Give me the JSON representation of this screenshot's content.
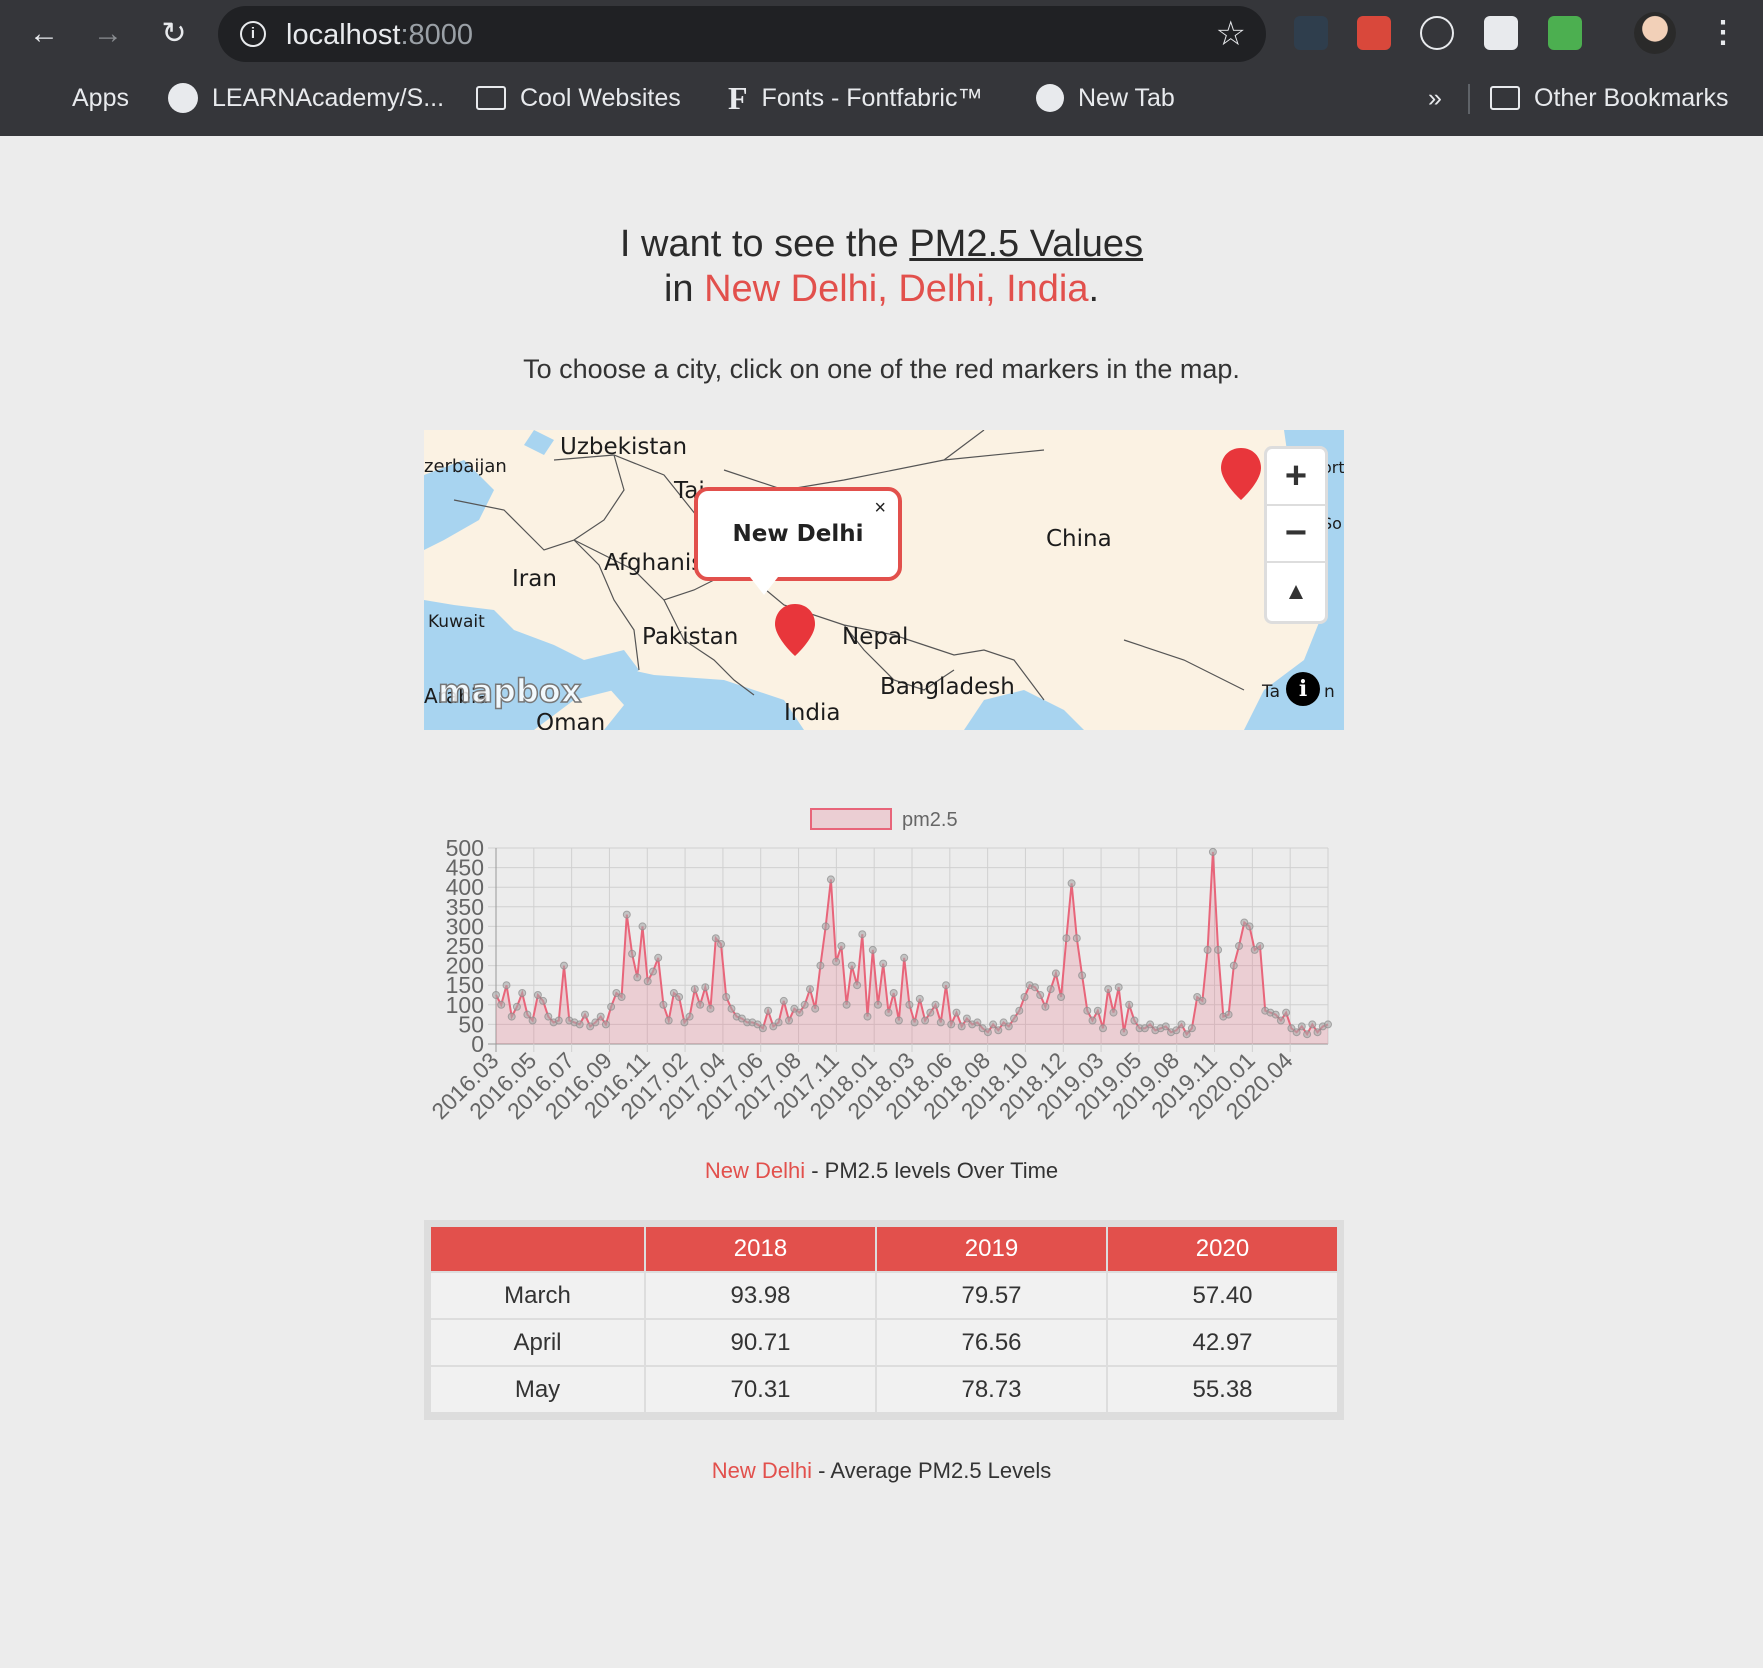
{
  "browser": {
    "url_host": "localhost",
    "url_port": ":8000",
    "bookmarks": [
      "Apps",
      "LEARNAcademy/S...",
      "Cool Websites",
      "Fonts - Fontfabric™",
      "New Tab"
    ],
    "overflow": "»",
    "other_bookmarks": "Other Bookmarks"
  },
  "page": {
    "headline_prefix": "I want to see the ",
    "headline_metric": "PM2.5 Values",
    "headline_in": "in ",
    "headline_city": "New Delhi, Delhi, India",
    "headline_period": ".",
    "instructions": "To choose a city, click on one of the red markers in the map."
  },
  "map": {
    "labels": [
      "Uzbekistan",
      "zerbaijan",
      "Taj",
      "China",
      "Iran",
      "Afghanis",
      "Kuwait",
      "Pakistan",
      "Nepal",
      "Bangladesh",
      "India",
      "Oman",
      "Arabia",
      "ort",
      "So",
      "Ta",
      "n"
    ],
    "popup_title": "New Delhi",
    "popup_close": "×",
    "zoom_in": "+",
    "zoom_out": "−",
    "compass": "▲",
    "attribution_logo": "mapbox",
    "info": "i"
  },
  "chart_data": {
    "type": "line",
    "legend": [
      "pm2.5"
    ],
    "legend_position": "top",
    "ylim": [
      0,
      500
    ],
    "yticks": [
      0,
      50,
      100,
      150,
      200,
      250,
      300,
      350,
      400,
      450,
      500
    ],
    "xticks": [
      "2016.03",
      "2016.05",
      "2016.07",
      "2016.09",
      "2016.11",
      "2017.02",
      "2017.04",
      "2017.06",
      "2017.08",
      "2017.11",
      "2018.01",
      "2018.03",
      "2018.06",
      "2018.08",
      "2018.10",
      "2018.12",
      "2019.03",
      "2019.05",
      "2019.08",
      "2019.11",
      "2020.01",
      "2020.04"
    ],
    "grid": true,
    "series": [
      {
        "name": "pm2.5",
        "color": "#e8657a",
        "fill": "rgba(232,101,122,0.22)",
        "values": [
          125,
          100,
          150,
          70,
          95,
          130,
          75,
          60,
          125,
          110,
          70,
          55,
          60,
          200,
          60,
          55,
          50,
          75,
          45,
          55,
          70,
          50,
          95,
          130,
          120,
          330,
          230,
          170,
          300,
          160,
          185,
          220,
          100,
          60,
          130,
          120,
          55,
          70,
          140,
          100,
          145,
          90,
          270,
          255,
          120,
          90,
          70,
          65,
          55,
          55,
          50,
          40,
          85,
          45,
          55,
          110,
          60,
          90,
          80,
          100,
          140,
          90,
          200,
          300,
          420,
          210,
          250,
          100,
          200,
          150,
          280,
          70,
          240,
          100,
          205,
          80,
          130,
          60,
          220,
          100,
          55,
          115,
          60,
          80,
          100,
          55,
          150,
          50,
          80,
          45,
          65,
          50,
          55,
          40,
          30,
          50,
          35,
          55,
          45,
          65,
          85,
          120,
          150,
          145,
          125,
          95,
          140,
          180,
          120,
          270,
          410,
          270,
          175,
          85,
          60,
          85,
          40,
          140,
          80,
          145,
          30,
          100,
          60,
          40,
          40,
          50,
          35,
          40,
          45,
          30,
          35,
          50,
          25,
          40,
          120,
          110,
          240,
          490,
          240,
          70,
          75,
          200,
          250,
          310,
          300,
          240,
          250,
          85,
          80,
          75,
          60,
          80,
          40,
          30,
          45,
          25,
          50,
          30,
          45,
          50
        ]
      }
    ]
  },
  "chart_caption_city": "New Delhi",
  "chart_caption_rest": " - PM2.5 levels Over Time",
  "table": {
    "headers": [
      "",
      "2018",
      "2019",
      "2020"
    ],
    "rows": [
      [
        "March",
        "93.98",
        "79.57",
        "57.40"
      ],
      [
        "April",
        "90.71",
        "76.56",
        "42.97"
      ],
      [
        "May",
        "70.31",
        "78.73",
        "55.38"
      ]
    ]
  },
  "table_caption_city": "New Delhi",
  "table_caption_rest": " - Average PM2.5 Levels",
  "colors": {
    "accent": "#e2504c",
    "chrome_bg": "#35363a",
    "page_bg": "#ececec"
  }
}
